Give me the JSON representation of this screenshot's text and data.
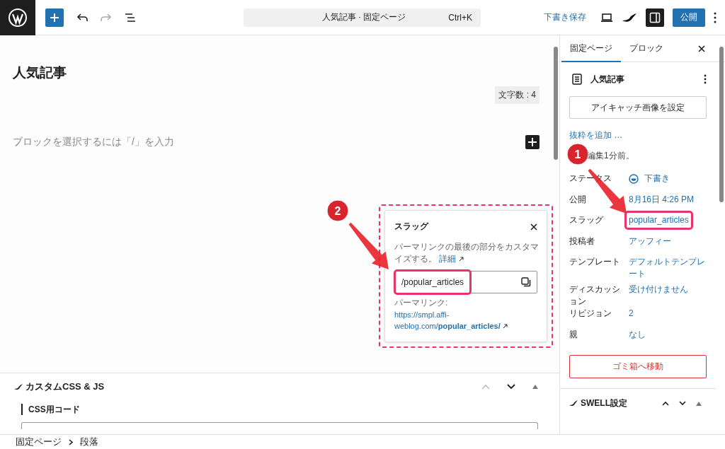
{
  "toolbar": {
    "title": "人気記事 · 固定ページ",
    "shortcut": "Ctrl+K",
    "save_draft": "下書き保存",
    "publish": "公開"
  },
  "editor": {
    "title": "人気記事",
    "char_count": "文字数 : 4",
    "placeholder": "ブロックを選択するには「/」を入力"
  },
  "slug_popover": {
    "outlined": true,
    "title": "スラッグ",
    "description": "パーマリンクの最後の部分をカスタマイズする。",
    "learn_more": "詳細",
    "slug_value": "/popular_articles",
    "slug_highlighted": true,
    "permalink_label": "パーマリンク:",
    "permalink": "https://smpl.affi-weblog.com/**popular_articles/**"
  },
  "custom_css_panel": {
    "title": "カスタムCSS & JS",
    "subheading": "CSS用コード"
  },
  "sidebar": {
    "tabs": [
      {
        "label": "固定ページ",
        "selected": true
      },
      {
        "label": "ブロック",
        "selected": false
      }
    ],
    "page_title": "人気記事",
    "featured_image_button": "アイキャッチ画像を設定",
    "excerpt_link": "抜粋を追加 …",
    "last_edited": "編集1分前。",
    "fields": [
      {
        "label": "ステータス",
        "value": "下書き",
        "kind": "status",
        "highlighted": false
      },
      {
        "label": "公開",
        "value": "8月16日 4:26 PM",
        "kind": "link",
        "highlighted": false
      },
      {
        "label": "スラッグ",
        "value": "popular_articles",
        "kind": "link",
        "highlighted": true
      },
      {
        "label": "投稿者",
        "value": "アッフィー",
        "kind": "link",
        "highlighted": false
      },
      {
        "label": "テンプレート",
        "value": "デフォルトテンプレート",
        "kind": "link",
        "highlighted": false
      },
      {
        "label": "ディスカッション",
        "value": "受け付けません",
        "kind": "link",
        "highlighted": false
      },
      {
        "label": "リビジョン",
        "value": "2",
        "kind": "link",
        "highlighted": false
      },
      {
        "label": "親",
        "value": "なし",
        "kind": "link",
        "highlighted": false
      }
    ],
    "trash_button": "ゴミ箱へ移動",
    "swell_panel": {
      "title": "SWELL設定"
    }
  },
  "breadcrumb": [
    "固定ページ",
    "段落"
  ],
  "annotations": [
    {
      "label": "1"
    },
    {
      "label": "2"
    }
  ]
}
